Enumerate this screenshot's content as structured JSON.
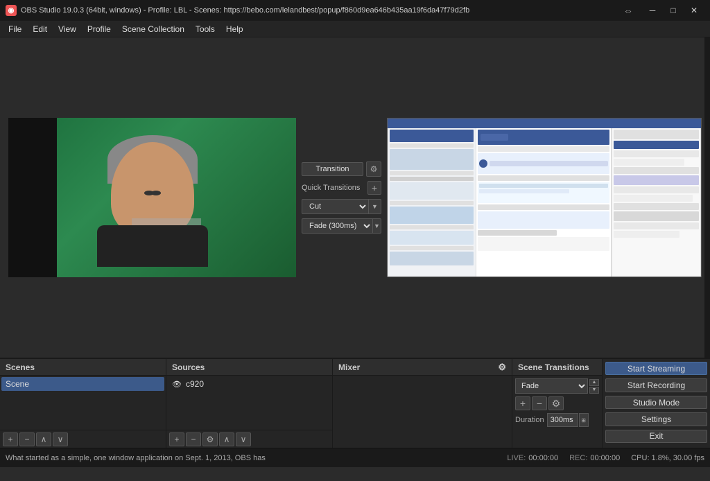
{
  "titlebar": {
    "icon_text": "●",
    "title": "OBS Studio 19.0.3 (64bit, windows) - Profile: LBL - Scenes: https://bebo.com/lelandbest/popup/f860d9ea646b435aa19f6da47f79d2fb",
    "minimize_label": "─",
    "maximize_label": "□",
    "close_label": "✕"
  },
  "menubar": {
    "items": [
      "File",
      "Edit",
      "View",
      "Profile",
      "Scene Collection",
      "Tools",
      "Help"
    ]
  },
  "transition_panel": {
    "transition_label": "Transition",
    "quick_transitions_label": "Quick Transitions",
    "cut_label": "Cut",
    "fade_label": "Fade (300ms)"
  },
  "bottom_panels": {
    "scenes_header": "Scenes",
    "sources_header": "Sources",
    "mixer_header": "Mixer",
    "scene_transitions_header": "Scene Transitions"
  },
  "scenes_panel": {
    "items": [
      {
        "label": "Scene",
        "selected": true
      }
    ]
  },
  "sources_panel": {
    "items": [
      {
        "label": "c920",
        "has_eye": true
      }
    ]
  },
  "transitions_panel": {
    "dropdown_value": "Fade",
    "duration_label": "Duration",
    "duration_value": "300ms"
  },
  "controls_panel": {
    "start_streaming_label": "Start Streaming",
    "start_recording_label": "Start Recording",
    "studio_mode_label": "Studio Mode",
    "settings_label": "Settings",
    "exit_label": "Exit"
  },
  "statusbar": {
    "live_label": "LIVE:",
    "live_time": "00:00:00",
    "rec_label": "REC:",
    "rec_time": "00:00:00",
    "cpu_label": "CPU: 1.8%, 30.00 fps",
    "bottom_text": "What started as a simple, one window application on Sept. 1, 2013, OBS has"
  },
  "toolbar_icons": {
    "add": "+",
    "remove": "−",
    "up": "∧",
    "down": "∨",
    "gear": "⚙",
    "settings_gear": "⚙",
    "plus": "+",
    "minus": "−"
  }
}
